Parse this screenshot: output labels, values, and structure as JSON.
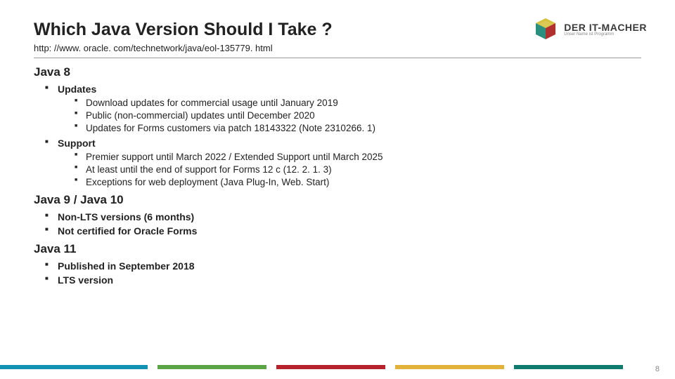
{
  "title": "Which Java Version Should I Take ?",
  "url": "http: //www. oracle. com/technetwork/java/eol-135779. html",
  "logo": {
    "main": "DER IT-MACHER",
    "sub": "Unser Name ist Programm"
  },
  "sections": [
    {
      "heading": "Java 8",
      "items": [
        {
          "label": "Updates",
          "sub": [
            "Download updates for commercial usage until January 2019",
            "Public (non-commercial) updates until December 2020",
            "Updates for Forms customers via patch 18143322 (Note 2310266. 1)"
          ]
        },
        {
          "label": "Support",
          "sub": [
            "Premier support until March 2022 / Extended Support until March 2025",
            "At least until the end of support for Forms 12 c (12. 2. 1. 3)",
            "Exceptions for web deployment (Java Plug-In, Web. Start)"
          ]
        }
      ]
    },
    {
      "heading": "Java 9 / Java 10",
      "items": [
        {
          "label": "Non-LTS versions (6 months)",
          "sub": []
        },
        {
          "label": "Not certified for Oracle Forms",
          "sub": []
        }
      ]
    },
    {
      "heading": "Java 11",
      "items": [
        {
          "label": "Published in September 2018",
          "sub": []
        },
        {
          "label": "LTS version",
          "sub": []
        }
      ]
    }
  ],
  "stripe": [
    "#1393b3",
    "#5ba546",
    "#b8222c",
    "#e2b23a",
    "#0f7c6f"
  ],
  "page": "8"
}
